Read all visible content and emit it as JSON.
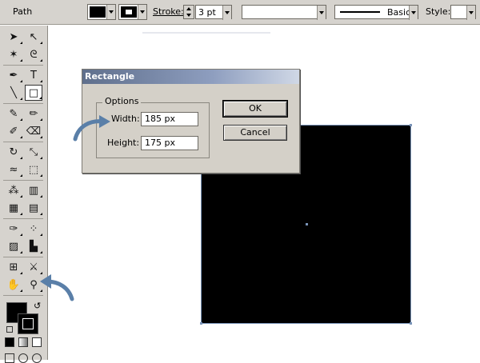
{
  "control_bar": {
    "object_type": "Path",
    "fill_swatch_color": "#000000",
    "stroke_label": "Stroke:",
    "stroke_weight": "3 pt",
    "brush_style": "Basic",
    "style_label": "Style:"
  },
  "tools": {
    "items": [
      {
        "name": "selection-tool",
        "glyph": "➤"
      },
      {
        "name": "direct-selection-tool",
        "glyph": "↖"
      },
      {
        "name": "magic-wand-tool",
        "glyph": "✶"
      },
      {
        "name": "lasso-tool",
        "glyph": "ᘓ"
      },
      {
        "name": "pen-tool",
        "glyph": "✒"
      },
      {
        "name": "type-tool",
        "glyph": "T"
      },
      {
        "name": "line-tool",
        "glyph": "╲"
      },
      {
        "name": "rectangle-tool",
        "glyph": "□"
      },
      {
        "name": "paintbrush-tool",
        "glyph": "✎"
      },
      {
        "name": "pencil-tool",
        "glyph": "✏"
      },
      {
        "name": "blob-brush-tool",
        "glyph": "✐"
      },
      {
        "name": "eraser-tool",
        "glyph": "⌫"
      },
      {
        "name": "rotate-tool",
        "glyph": "↻"
      },
      {
        "name": "scale-tool",
        "glyph": "⤡"
      },
      {
        "name": "warp-tool",
        "glyph": "≈"
      },
      {
        "name": "free-transform-tool",
        "glyph": "⬚"
      },
      {
        "name": "symbol-sprayer-tool",
        "glyph": "⁂"
      },
      {
        "name": "graph-tool",
        "glyph": "▥"
      },
      {
        "name": "mesh-tool",
        "glyph": "▦"
      },
      {
        "name": "gradient-tool",
        "glyph": "▤"
      },
      {
        "name": "eyedropper-tool",
        "glyph": "✑"
      },
      {
        "name": "blend-tool",
        "glyph": "⁘"
      },
      {
        "name": "column-graph-tool",
        "glyph": "▨"
      },
      {
        "name": "bar-graph-tool",
        "glyph": "▙"
      },
      {
        "name": "artboard-tool",
        "glyph": "⊞"
      },
      {
        "name": "slice-tool",
        "glyph": "⚔"
      },
      {
        "name": "hand-tool",
        "glyph": "✋"
      },
      {
        "name": "zoom-tool",
        "glyph": "⚲"
      }
    ],
    "fill_color": "#000000",
    "stroke_color": "#000000"
  },
  "dialog": {
    "title": "Rectangle",
    "group_label": "Options",
    "width_label": "Width:",
    "width_value": "185 px",
    "height_label": "Height:",
    "height_value": "175 px",
    "ok_label": "OK",
    "cancel_label": "Cancel"
  },
  "colors": {
    "accent_arrow": "#5a7fa8",
    "selection": "#7a94b8",
    "panel": "#d6d3ce"
  }
}
